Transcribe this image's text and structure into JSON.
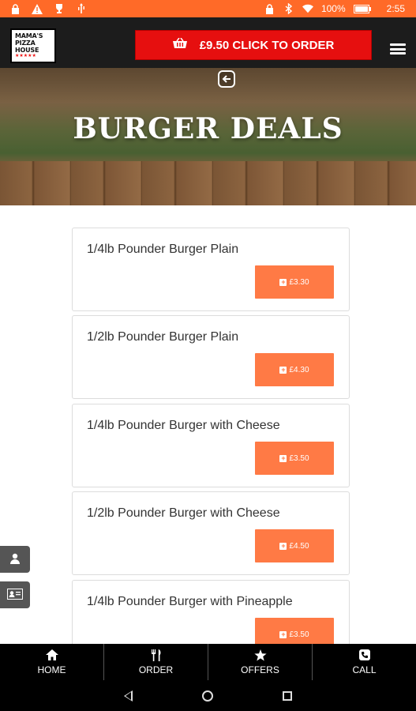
{
  "status_bar": {
    "battery_percent": "100%",
    "time": "2:55",
    "left_icons": [
      "lock-icon",
      "warning-icon",
      "trophy-icon",
      "usb-icon"
    ],
    "right_icons": [
      "lock-icon",
      "bluetooth-icon",
      "wifi-icon",
      "battery-icon"
    ]
  },
  "header": {
    "logo_lines": [
      "MAMA'S",
      "PIZZA",
      "HOUSE"
    ],
    "logo_stars": "★★★★★",
    "order_label": "£9.50 CLICK TO ORDER",
    "order_color": "#e60f0f"
  },
  "hero": {
    "title": "BURGER DEALS",
    "back_icon": "arrow-left-icon"
  },
  "items": [
    {
      "name": "1/4lb Pounder Burger Plain",
      "price": "£3.30"
    },
    {
      "name": "1/2lb Pounder Burger Plain",
      "price": "£4.30"
    },
    {
      "name": "1/4lb Pounder Burger with Cheese",
      "price": "£3.50"
    },
    {
      "name": "1/2lb Pounder Burger with Cheese",
      "price": "£4.50"
    },
    {
      "name": "1/4lb Pounder Burger with Pineapple",
      "price": "£3.50"
    }
  ],
  "accent_color": "#ff7a45",
  "bottom_nav": [
    {
      "label": "HOME",
      "icon": "home-icon"
    },
    {
      "label": "ORDER",
      "icon": "cutlery-icon"
    },
    {
      "label": "OFFERS",
      "icon": "star-icon"
    },
    {
      "label": "CALL",
      "icon": "phone-icon"
    }
  ]
}
